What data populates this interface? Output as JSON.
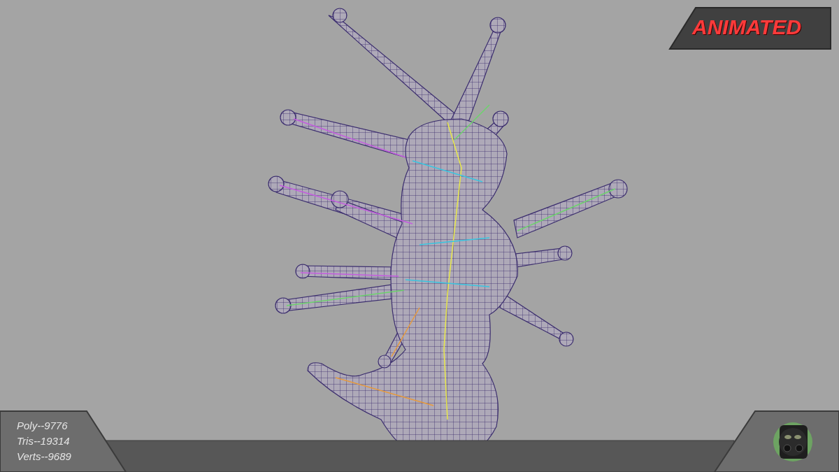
{
  "badge": {
    "label": "ANIMATED"
  },
  "stats": [
    "Poly--9776",
    "Tris--19314",
    "Verts--9689"
  ]
}
